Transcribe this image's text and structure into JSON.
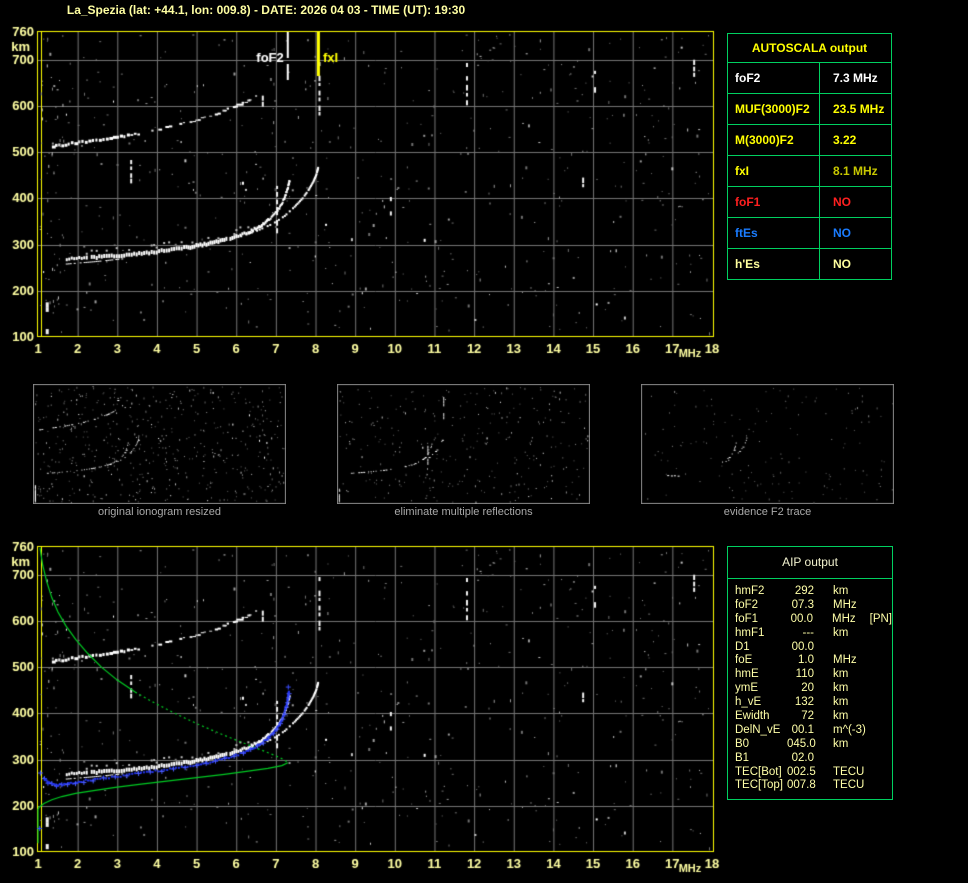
{
  "title": "La_Spezia (lat: +44.1, lon: 009.8) - DATE: 2026 04 03 - TIME (UT): 19:30",
  "colors": {
    "background": "#000000",
    "plot_border": "#ffff00",
    "axis_text": "#ffffa2",
    "grid": "#757575",
    "table_border": "#00d060",
    "trace_white": "#ffffff",
    "profile_green": "#00cc22",
    "restored_blue": "#2233ee",
    "caption_gray": "#a9a9a9",
    "panel_border": "#8a8a8a",
    "title_yellow": "#ffffa2"
  },
  "autoscala_table": {
    "header": "AUTOSCALA output",
    "rows": [
      {
        "label": "foF2",
        "value": "7.3 MHz",
        "label_color": "#ffffff",
        "value_color": "#ffffff"
      },
      {
        "label": "MUF(3000)F2",
        "value": "23.5 MHz",
        "label_color": "#ffff00",
        "value_color": "#ffff00"
      },
      {
        "label": "M(3000)F2",
        "value": "3.22",
        "label_color": "#ffff00",
        "value_color": "#ffff00"
      },
      {
        "label": "fxI",
        "value": "8.1 MHz",
        "label_color": "#ffff00",
        "value_color": "#c8c800"
      },
      {
        "label": "foF1",
        "value": "NO",
        "label_color": "#ff2020",
        "value_color": "#ff2020"
      },
      {
        "label": "ftEs",
        "value": "NO",
        "label_color": "#1a7cff",
        "value_color": "#1a7cff"
      },
      {
        "label": "h'Es",
        "value": "NO",
        "label_color": "#ffff9e",
        "value_color": "#ffff9e"
      }
    ]
  },
  "aip_table": {
    "header": "AIP output",
    "rows": [
      {
        "label": "hmF2",
        "value": "292",
        "unit": "km",
        "extra": ""
      },
      {
        "label": "foF2",
        "value": "07.3",
        "unit": "MHz",
        "extra": ""
      },
      {
        "label": "foF1",
        "value": "00.0",
        "unit": "MHz",
        "extra": "[PN]"
      },
      {
        "label": "hmF1",
        "value": "---",
        "unit": "km",
        "extra": ""
      },
      {
        "label": "D1",
        "value": "00.0",
        "unit": "",
        "extra": ""
      },
      {
        "label": "foE",
        "value": "1.0",
        "unit": "MHz",
        "extra": ""
      },
      {
        "label": "hmE",
        "value": "110",
        "unit": "km",
        "extra": ""
      },
      {
        "label": "ymE",
        "value": "20",
        "unit": "km",
        "extra": ""
      },
      {
        "label": "h_vE",
        "value": "132",
        "unit": "km",
        "extra": ""
      },
      {
        "label": "Ewidth",
        "value": "72",
        "unit": "km",
        "extra": ""
      },
      {
        "label": "DelN_vE",
        "value": "00.1",
        "unit": "m^(-3)",
        "extra": ""
      },
      {
        "label": "B0",
        "value": "045.0",
        "unit": "km",
        "extra": ""
      },
      {
        "label": "B1",
        "value": "02.0",
        "unit": "",
        "extra": ""
      },
      {
        "label": "TEC[Bot]",
        "value": "002.5",
        "unit": "TECU",
        "extra": ""
      },
      {
        "label": "TEC[Top]",
        "value": "007.8",
        "unit": "TECU",
        "extra": ""
      }
    ]
  },
  "panels": [
    {
      "caption": "original ionogram resized"
    },
    {
      "caption": "eliminate multiple reflections"
    },
    {
      "caption": "evidence F2 trace"
    }
  ],
  "axes": {
    "x_ticks": [
      "1",
      "2",
      "3",
      "4",
      "5",
      "6",
      "7",
      "8",
      "9",
      "10",
      "11",
      "12",
      "13",
      "14",
      "15",
      "16",
      "17",
      "18"
    ],
    "x_unit": "MHz",
    "y_ticks": [
      "760",
      "700",
      "600",
      "500",
      "400",
      "300",
      "200",
      "100"
    ],
    "y_unit": "km"
  },
  "markers": {
    "foF2_label": "foF2",
    "foF2_mhz": 7.3,
    "fxI_label": "fxI",
    "fxI_mhz": 8.06
  },
  "chart_data": [
    {
      "type": "scatter",
      "title": "ionogram with AUTOSCALA scaling markers",
      "xlabel": "MHz",
      "ylabel": "km",
      "xlim": [
        1,
        18
      ],
      "ylim": [
        100,
        760
      ],
      "x_ticks": [
        1,
        2,
        3,
        4,
        5,
        6,
        7,
        8,
        9,
        10,
        11,
        12,
        13,
        14,
        15,
        16,
        17,
        18
      ],
      "y_ticks": [
        760,
        700,
        600,
        500,
        400,
        300,
        200,
        100
      ],
      "grid": true,
      "markers": {
        "foF2_MHz": 7.3,
        "fxI_MHz": 8.06,
        "MUF3000F2_MHz": 23.5,
        "M3000F2": 3.22
      },
      "series": [
        {
          "name": "F2-trace-O-mode",
          "color": "#ffffff",
          "points": [
            [
              1.7,
              268
            ],
            [
              2.2,
              271
            ],
            [
              2.7,
              274
            ],
            [
              3.2,
              278
            ],
            [
              3.7,
              282
            ],
            [
              4.2,
              287
            ],
            [
              4.7,
              293
            ],
            [
              5.1,
              299
            ],
            [
              5.5,
              306
            ],
            [
              5.9,
              315
            ],
            [
              6.3,
              327
            ],
            [
              6.6,
              341
            ],
            [
              6.85,
              357
            ],
            [
              7.05,
              377
            ],
            [
              7.18,
              398
            ],
            [
              7.27,
              420
            ],
            [
              7.32,
              438
            ]
          ]
        },
        {
          "name": "F2-trace-X-mode",
          "color": "#ffffff",
          "points": [
            [
              6.1,
              318
            ],
            [
              6.5,
              330
            ],
            [
              6.9,
              345
            ],
            [
              7.2,
              362
            ],
            [
              7.45,
              382
            ],
            [
              7.65,
              400
            ],
            [
              7.8,
              418
            ],
            [
              7.92,
              436
            ],
            [
              8.0,
              452
            ],
            [
              8.04,
              466
            ]
          ]
        },
        {
          "name": "second-order-echo",
          "color": "#ffffff",
          "points": [
            [
              1.35,
              512
            ],
            [
              1.8,
              518
            ],
            [
              2.3,
              524
            ],
            [
              2.8,
              530
            ],
            [
              3.3,
              537
            ],
            [
              3.8,
              545
            ],
            [
              4.3,
              554
            ],
            [
              4.8,
              565
            ],
            [
              5.2,
              575
            ],
            [
              5.6,
              587
            ],
            [
              5.9,
              597
            ],
            [
              6.15,
              606
            ],
            [
              6.35,
              614
            ]
          ]
        },
        {
          "name": "O-X-split-start",
          "color": "#ffffff",
          "points": [
            [
              1.7,
              259
            ],
            [
              2.4,
              264
            ],
            [
              3.1,
              270
            ]
          ]
        }
      ],
      "interference_streaks_MHz_kmRange": [
        [
          3.35,
          425,
          483
        ],
        [
          7.03,
          330,
          427
        ],
        [
          8.1,
          585,
          695
        ],
        [
          11.82,
          605,
          705
        ],
        [
          15.05,
          638,
          676
        ],
        [
          6.67,
          590,
          640
        ],
        [
          9.9,
          347,
          403
        ],
        [
          1.22,
          95,
          175
        ],
        [
          17.55,
          640,
          700
        ],
        [
          14.75,
          425,
          445
        ]
      ]
    },
    {
      "type": "scatter",
      "title": "same ionogram with AIP profile overlay",
      "xlabel": "MHz",
      "ylabel": "km",
      "xlim": [
        1,
        18
      ],
      "ylim": [
        100,
        760
      ],
      "same_ionogram_as_first": true,
      "profile": {
        "name": "electron-density-profile",
        "color": "#00cc22",
        "topside": [
          [
            1.05,
            758
          ],
          [
            1.12,
            720
          ],
          [
            1.22,
            685
          ],
          [
            1.35,
            650
          ],
          [
            1.5,
            620
          ],
          [
            1.7,
            590
          ],
          [
            1.95,
            560
          ],
          [
            2.25,
            530
          ],
          [
            2.6,
            500
          ],
          [
            3.0,
            472
          ],
          [
            3.45,
            446
          ],
          [
            3.95,
            422
          ],
          [
            4.5,
            398
          ],
          [
            5.05,
            376
          ],
          [
            5.6,
            356
          ],
          [
            6.15,
            337
          ],
          [
            6.65,
            320
          ],
          [
            7.0,
            308
          ],
          [
            7.2,
            300
          ],
          [
            7.3,
            293
          ]
        ],
        "dashed_topside_MHz_range": [
          3.45,
          7.05
        ],
        "bottomside": [
          [
            7.3,
            293
          ],
          [
            7.15,
            287
          ],
          [
            6.8,
            281
          ],
          [
            6.3,
            275
          ],
          [
            5.7,
            268
          ],
          [
            5.0,
            261
          ],
          [
            4.3,
            254
          ],
          [
            3.6,
            247
          ],
          [
            2.95,
            240
          ],
          [
            2.4,
            233
          ],
          [
            1.95,
            227
          ],
          [
            1.6,
            220
          ],
          [
            1.35,
            213
          ],
          [
            1.15,
            205
          ],
          [
            1.03,
            197
          ],
          [
            1.0,
            193
          ]
        ],
        "valley": [
          [
            1.0,
            193
          ],
          [
            1.0,
            119
          ]
        ]
      },
      "restored_trace": {
        "name": "restored-F2-trace",
        "color": "#2233ee",
        "points": [
          [
            1.15,
            258
          ],
          [
            1.3,
            248
          ],
          [
            1.5,
            245
          ],
          [
            1.75,
            248
          ],
          [
            2.1,
            253
          ],
          [
            2.5,
            258
          ],
          [
            3.0,
            264
          ],
          [
            3.5,
            269
          ],
          [
            4.0,
            275
          ],
          [
            4.5,
            281
          ],
          [
            5.0,
            288
          ],
          [
            5.4,
            295
          ],
          [
            5.8,
            304
          ],
          [
            6.2,
            315
          ],
          [
            6.5,
            328
          ],
          [
            6.75,
            342
          ],
          [
            6.95,
            358
          ],
          [
            7.1,
            377
          ],
          [
            7.2,
            397
          ],
          [
            7.27,
            417
          ],
          [
            7.31,
            437
          ],
          [
            7.33,
            447
          ]
        ],
        "isolated_points": [
          [
            1.03,
            152
          ],
          [
            1.05,
            272
          ],
          [
            7.3,
            458
          ]
        ]
      }
    }
  ]
}
